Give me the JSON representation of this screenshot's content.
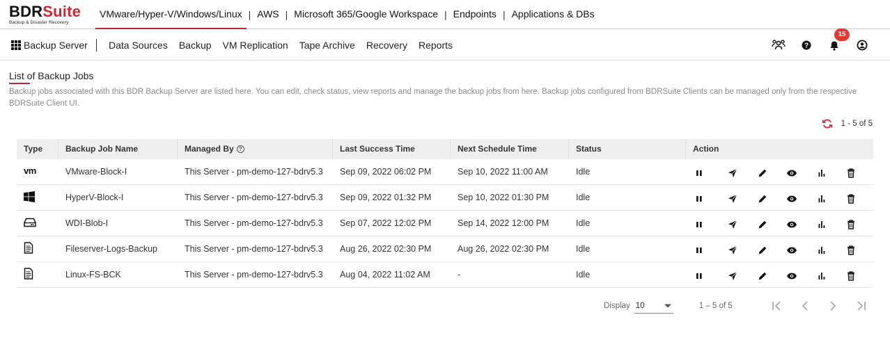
{
  "brand": {
    "name_part1": "BDR",
    "name_part2": "Suite",
    "tagline": "Backup & Disaster Recovery",
    "accent": "#c0262d"
  },
  "topnav": {
    "items": [
      "VMware/Hyper-V/Windows/Linux",
      "AWS",
      "Microsoft 365/Google Workspace",
      "Endpoints",
      "Applications & DBs"
    ],
    "active_index": 0,
    "separator": "|"
  },
  "subnav": {
    "server_label": "Backup Server",
    "items": [
      "Data Sources",
      "Backup",
      "VM Replication",
      "Tape Archive",
      "Recovery",
      "Reports"
    ]
  },
  "header_icons": {
    "notification_count": "15",
    "icons": [
      "users-icon",
      "help-icon",
      "bell-icon",
      "account-icon"
    ],
    "badge_color": "#e53935"
  },
  "page": {
    "title": "List of Backup Jobs",
    "description": "Backup jobs associated with this BDR Backup Server are listed here. You can edit, check status, view reports and manage the backup jobs from here. Backup jobs configured from BDRSuite Clients can be managed only from the respective BDRSuite Client UI.",
    "count_label": "1 - 5 of 5"
  },
  "table": {
    "headers": {
      "type": "Type",
      "name": "Backup Job Name",
      "managed": "Managed By",
      "last": "Last Success Time",
      "next": "Next Schedule Time",
      "status": "Status",
      "action": "Action"
    },
    "rows": [
      {
        "type_icon": "vmware-icon",
        "type_text": "vm",
        "name": "VMware-Block-I",
        "managed": "This Server - pm-demo-127-bdrv5.3",
        "last": "Sep 09, 2022 06:02 PM",
        "next": "Sep 10, 2022 11:00 AM",
        "status": "Idle"
      },
      {
        "type_icon": "windows-icon",
        "type_text": "",
        "name": "HyperV-Block-I",
        "managed": "This Server - pm-demo-127-bdrv5.3",
        "last": "Sep 09, 2022 01:32 PM",
        "next": "Sep 10, 2022 01:30 PM",
        "status": "Idle"
      },
      {
        "type_icon": "drive-icon",
        "type_text": "",
        "name": "WDI-Blob-I",
        "managed": "This Server - pm-demo-127-bdrv5.3",
        "last": "Sep 07, 2022 12:02 PM",
        "next": "Sep 14, 2022 12:00 PM",
        "status": "Idle"
      },
      {
        "type_icon": "file-icon",
        "type_text": "",
        "name": "Fileserver-Logs-Backup",
        "managed": "This Server - pm-demo-127-bdrv5.3",
        "last": "Aug 26, 2022 02:30 PM",
        "next": "Aug 26, 2022 02:30 PM",
        "status": "Idle"
      },
      {
        "type_icon": "file-icon",
        "type_text": "",
        "name": "Linux-FS-BCK",
        "managed": "This Server - pm-demo-127-bdrv5.3",
        "last": "Aug 04, 2022 11:02 AM",
        "next": "-",
        "status": "Idle"
      }
    ],
    "row_actions": [
      "pause-icon",
      "send-icon",
      "edit-icon",
      "view-icon",
      "report-icon",
      "delete-icon"
    ]
  },
  "pagination": {
    "display_label": "Display",
    "page_size": "10",
    "range": "1 – 5 of 5",
    "buttons": [
      "first-page-icon",
      "prev-page-icon",
      "next-page-icon",
      "last-page-icon"
    ]
  }
}
